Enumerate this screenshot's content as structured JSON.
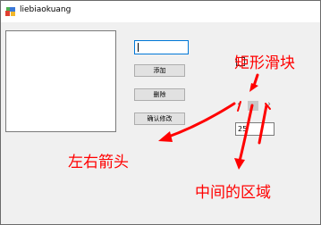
{
  "window": {
    "title": "liebiaokuang"
  },
  "form": {
    "textbox_value": "",
    "add_button": "添加",
    "delete_button": "删除",
    "confirm_button": "确认修改",
    "scroll_value": "25"
  },
  "annotations": {
    "thumb": "矩形滑块",
    "arrows": "左右箭头",
    "middle": "中间的区域"
  },
  "colors": {
    "annotation": "#ff0000",
    "focus_border": "#0078d7"
  }
}
